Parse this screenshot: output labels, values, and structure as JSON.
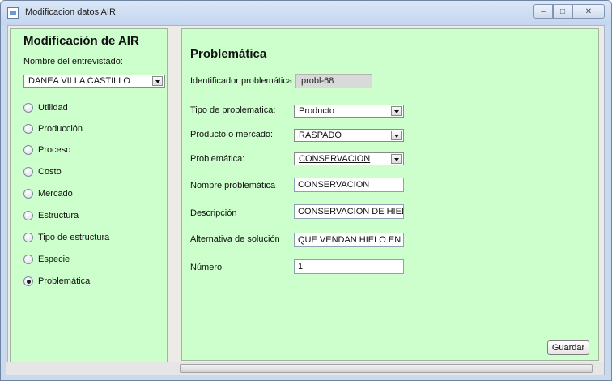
{
  "window": {
    "title": "Modificacion datos  AIR",
    "icons": {
      "app": "java-cup-icon",
      "minimize": "minimize-icon",
      "maximize": "maximize-icon",
      "close": "close-icon"
    }
  },
  "left": {
    "title": "Modificación de AIR",
    "interviewee_label": "Nombre del entrevistado:",
    "interviewee_value": "DANEA VILLA CASTILLO",
    "options": [
      {
        "label": "Utilidad",
        "checked": false
      },
      {
        "label": "Producción",
        "checked": false
      },
      {
        "label": "Proceso",
        "checked": false
      },
      {
        "label": "Costo",
        "checked": false
      },
      {
        "label": "Mercado",
        "checked": false
      },
      {
        "label": "Estructura",
        "checked": false
      },
      {
        "label": "Tipo de estructura",
        "checked": false
      },
      {
        "label": "Especie",
        "checked": false
      },
      {
        "label": "Problemática",
        "checked": true
      }
    ]
  },
  "form": {
    "title": "Problemática",
    "identificador_label": "Identificador problemática",
    "identificador_value": "probl-68",
    "tipo_label": "Tipo de problematica:",
    "tipo_value": "Producto",
    "producto_label": "Producto o mercado:",
    "producto_value": "RASPADO",
    "problematica_label": "Problemática:",
    "problematica_value": "CONSERVACION",
    "nombre_label": "Nombre problemática",
    "nombre_value": "CONSERVACION",
    "descripcion_label": "Descripción",
    "descripcion_value": "CONSERVACION DE HIELO",
    "alternativa_label": "Alternativa de solución",
    "alternativa_value": "QUE VENDAN HIELO EN SC",
    "numero_label": "Número",
    "numero_value": "1",
    "save_label": "Guardar"
  },
  "colors": {
    "panel_green": "#ccffcc",
    "frame": "#c9d9ee"
  }
}
